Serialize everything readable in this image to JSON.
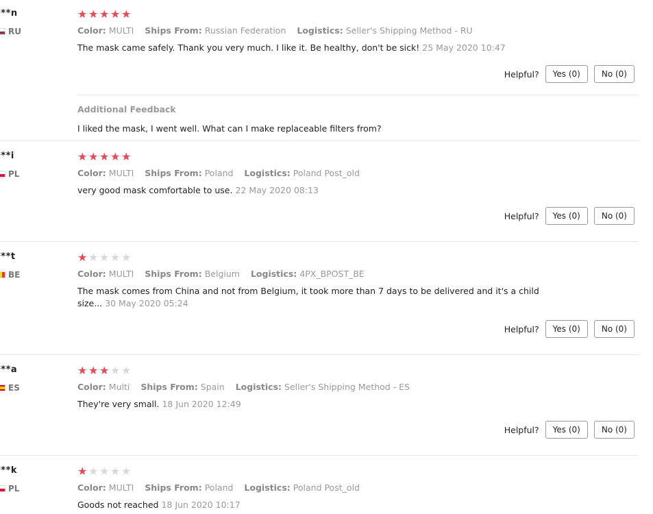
{
  "helpful_label": "Helpful?",
  "reviews": [
    {
      "user": "***n",
      "country": "RU",
      "flag_colors": [
        "#ffffff",
        "#2a50a5",
        "#d52b1e"
      ],
      "rating": 5,
      "color_label": "Color:",
      "color_value": "MULTI",
      "ships_label": "Ships From:",
      "ships_value": "Russian Federation",
      "logistics_label": "Logistics:",
      "logistics_value": "Seller's Shipping Method - RU",
      "text": "The mask came safely. Thank you very much. I like it. Be healthy, don't be sick!",
      "date": "25 May 2020 10:47",
      "yes": "Yes (0)",
      "no": "No (0)",
      "additional_title": "Additional Feedback",
      "additional_text": "I liked the mask, I went well. What can I make replaceable filters from?"
    },
    {
      "user": "***i",
      "country": "PL",
      "flag_colors": [
        "#ffffff",
        "#dc143c"
      ],
      "rating": 5,
      "color_label": "Color:",
      "color_value": "MULTI",
      "ships_label": "Ships From:",
      "ships_value": "Poland",
      "logistics_label": "Logistics:",
      "logistics_value": "Poland Post_old",
      "text": "very good mask comfortable to use.",
      "date": "22 May 2020 08:13",
      "yes": "Yes (0)",
      "no": "No (0)"
    },
    {
      "user": "***t",
      "country": "BE",
      "flag_colors": [
        "#000000",
        "#fdda24",
        "#ef3340"
      ],
      "rating": 1,
      "color_label": "Color:",
      "color_value": "MULTI",
      "ships_label": "Ships From:",
      "ships_value": "Belgium",
      "logistics_label": "Logistics:",
      "logistics_value": "4PX_BPOST_BE",
      "text": "The mask comes from China and not from Belgium, it took more than 7 days to be delivered and it's a child size...",
      "date": "30 May 2020 05:24",
      "yes": "Yes (0)",
      "no": "No (0)"
    },
    {
      "user": "***a",
      "country": "ES",
      "flag_colors": [
        "#c60b1e",
        "#ffc400"
      ],
      "rating": 3,
      "color_label": "Color:",
      "color_value": "Multi",
      "ships_label": "Ships From:",
      "ships_value": "Spain",
      "logistics_label": "Logistics:",
      "logistics_value": "Seller's Shipping Method - ES",
      "text": "They're very small.",
      "date": "18 Jun 2020 12:49",
      "yes": "Yes (0)",
      "no": "No (0)"
    },
    {
      "user": "***k",
      "country": "PL",
      "flag_colors": [
        "#ffffff",
        "#dc143c"
      ],
      "rating": 1,
      "color_label": "Color:",
      "color_value": "MULTI",
      "ships_label": "Ships From:",
      "ships_value": "Poland",
      "logistics_label": "Logistics:",
      "logistics_value": "Poland Post_old",
      "text": "Goods not reached",
      "date": "18 Jun 2020 10:17"
    }
  ]
}
